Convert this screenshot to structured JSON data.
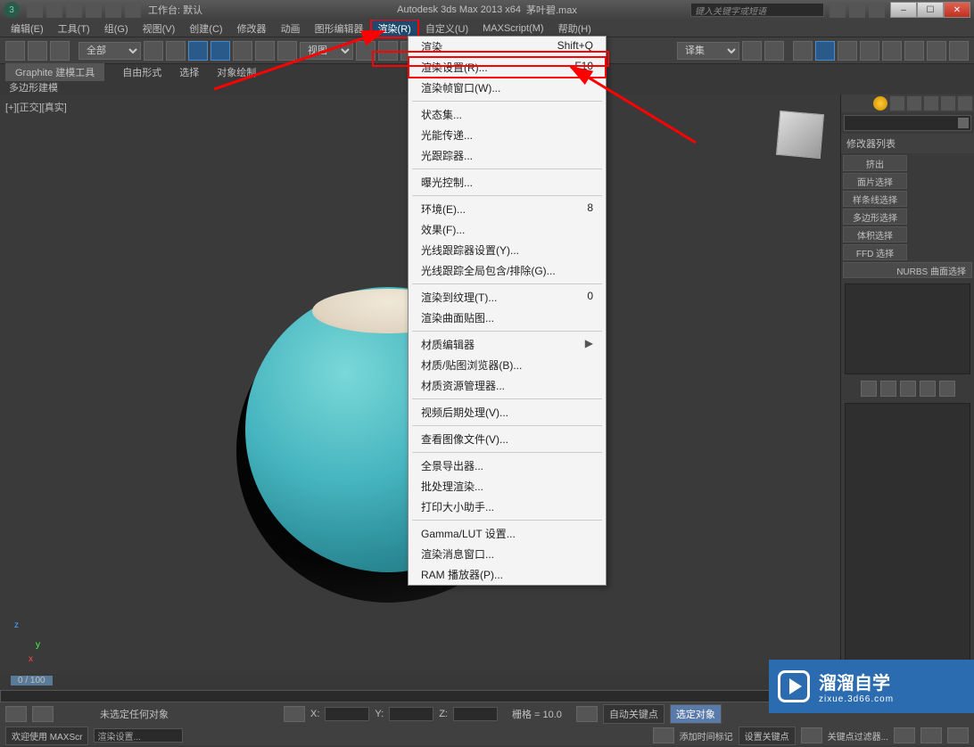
{
  "title": {
    "app": "Autodesk 3ds Max 2013 x64",
    "file": "茅叶碧.max",
    "workspace": "工作台: 默认"
  },
  "search_placeholder": "键入关键字或短语",
  "menubar": [
    "编辑(E)",
    "工具(T)",
    "组(G)",
    "视图(V)",
    "创建(C)",
    "修改器",
    "动画",
    "图形编辑器",
    "渲染(R)",
    "自定义(U)",
    "MAXScript(M)",
    "帮助(H)"
  ],
  "toolbar_select": "全部",
  "view_select": "视图",
  "subtabs": {
    "graphite": "Graphite 建模工具",
    "free": "自由形式",
    "select": "选择",
    "paint": "对象绘制"
  },
  "polymod": "多边形建模",
  "viewport_label": "[+][正交][真实]",
  "dropdown": {
    "groups": [
      [
        {
          "l": "渲染",
          "s": "Shift+Q"
        },
        {
          "l": "渲染设置(R)...",
          "s": "F10",
          "hi": true
        },
        {
          "l": "渲染帧窗口(W)..."
        }
      ],
      [
        {
          "l": "状态集..."
        },
        {
          "l": "光能传递..."
        },
        {
          "l": "光跟踪器..."
        }
      ],
      [
        {
          "l": "曝光控制..."
        }
      ],
      [
        {
          "l": "环境(E)...",
          "s": "8"
        },
        {
          "l": "效果(F)..."
        },
        {
          "l": "光线跟踪器设置(Y)..."
        },
        {
          "l": "光线跟踪全局包含/排除(G)..."
        }
      ],
      [
        {
          "l": "渲染到纹理(T)...",
          "s": "0"
        },
        {
          "l": "渲染曲面贴图..."
        }
      ],
      [
        {
          "l": "材质编辑器",
          "arr": true
        },
        {
          "l": "材质/贴图浏览器(B)..."
        },
        {
          "l": "材质资源管理器..."
        }
      ],
      [
        {
          "l": "视频后期处理(V)..."
        }
      ],
      [
        {
          "l": "查看图像文件(V)..."
        }
      ],
      [
        {
          "l": "全景导出器..."
        },
        {
          "l": "批处理渲染..."
        },
        {
          "l": "打印大小助手..."
        }
      ],
      [
        {
          "l": "Gamma/LUT 设置..."
        },
        {
          "l": "渲染消息窗口..."
        },
        {
          "l": "RAM 播放器(P)..."
        }
      ]
    ]
  },
  "rpanel": {
    "modlist": "修改器列表",
    "buttons": [
      "挤出",
      "面片选择",
      "样条线选择",
      "多边形选择",
      "体积选择",
      "FFD 选择"
    ],
    "nurbs": "NURBS 曲面选择"
  },
  "timeline": "0 / 100",
  "status": {
    "none": "未选定任何对象",
    "x": "X:",
    "y": "Y:",
    "z": "Z:",
    "grid": "栅格 = 10.0",
    "autokey": "自动关键点",
    "selset": "选定对象",
    "addtime": "添加时间标记",
    "setkey": "设置关键点",
    "keyfilter": "关键点过滤器..."
  },
  "footer": {
    "welcome": "欢迎使用 MAXScr",
    "render": "渲染设置..."
  },
  "watermark": {
    "big": "溜溜自学",
    "small": "zixue.3d66.com"
  }
}
